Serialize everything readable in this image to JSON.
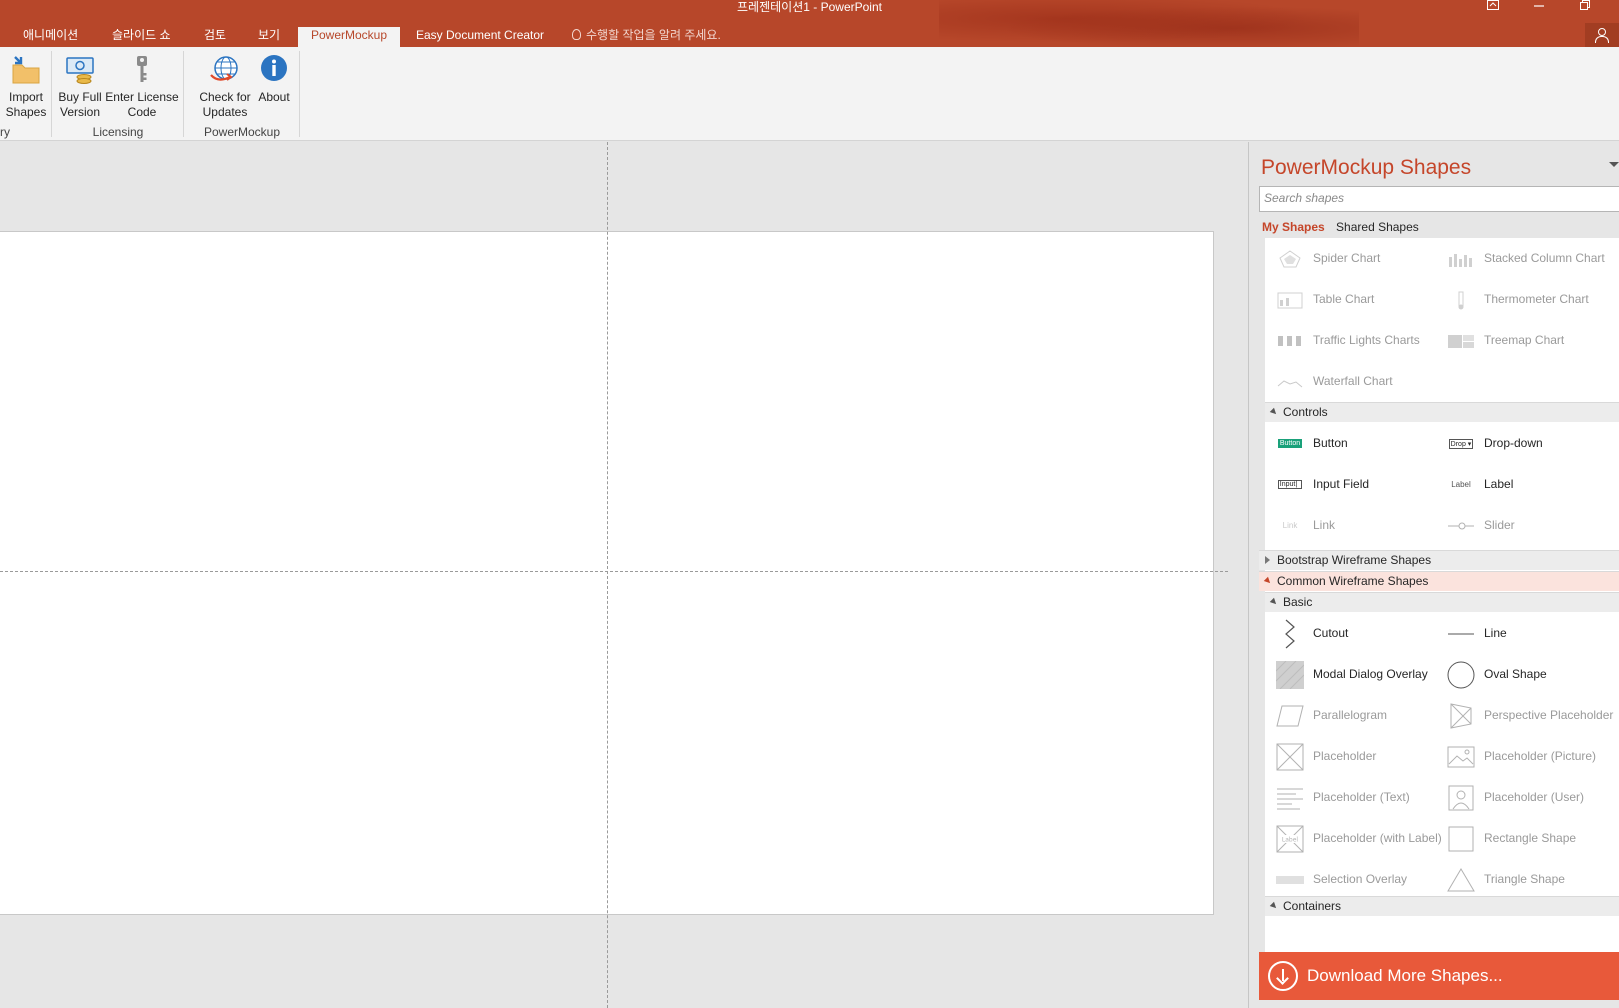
{
  "window": {
    "title": "프레젠테이션1 - PowerPoint",
    "controls": [
      "restore-ribbon",
      "minimize",
      "restore"
    ]
  },
  "tabs": [
    {
      "label": "애니메이션",
      "active": false
    },
    {
      "label": "슬라이드 쇼",
      "active": false
    },
    {
      "label": "검토",
      "active": false
    },
    {
      "label": "보기",
      "active": false
    },
    {
      "label": "PowerMockup",
      "active": true
    },
    {
      "label": "Easy Document Creator",
      "active": false
    }
  ],
  "tell_me": "수행할 작업을 알려 주세요.",
  "ribbon": {
    "buttons": [
      {
        "label1": "Import",
        "label2": "Shapes",
        "icon": "folder-import-icon"
      },
      {
        "label1": "Buy Full",
        "label2": "Version",
        "icon": "money-icon"
      },
      {
        "label1": "Enter License",
        "label2": "Code",
        "icon": "key-icon"
      },
      {
        "label1": "Check for",
        "label2": "Updates",
        "icon": "globe-update-icon"
      },
      {
        "label1": "About",
        "label2": "",
        "icon": "info-icon"
      }
    ],
    "groups": [
      "ry",
      "Licensing",
      "PowerMockup"
    ]
  },
  "pane": {
    "title": "PowerMockup Shapes",
    "search_placeholder": "Search shapes",
    "tab_my": "My Shapes",
    "tab_shared": "Shared Shapes",
    "charts": [
      [
        "Spider Chart",
        "Stacked Column Chart"
      ],
      [
        "Table Chart",
        "Thermometer Chart"
      ],
      [
        "Traffic Lights Charts",
        "Treemap Chart"
      ],
      [
        "Waterfall Chart",
        ""
      ]
    ],
    "controls_header": "Controls",
    "controls": [
      [
        "Button",
        "Drop-down"
      ],
      [
        "Input Field",
        "Label"
      ],
      [
        "Link",
        "Slider"
      ]
    ],
    "control_thumbs": {
      "button": "Button",
      "dropdown": "Drop ▾",
      "input": "Input|",
      "label": "Label",
      "link": "Link"
    },
    "bootstrap_header": "Bootstrap Wireframe Shapes",
    "common_header": "Common Wireframe Shapes",
    "basic_header": "Basic",
    "basic": [
      [
        "Cutout",
        "Line"
      ],
      [
        "Modal Dialog Overlay",
        "Oval Shape"
      ],
      [
        "Parallelogram",
        "Perspective Placeholder"
      ],
      [
        "Placeholder",
        "Placeholder (Picture)"
      ],
      [
        "Placeholder (Text)",
        "Placeholder (User)"
      ],
      [
        "Placeholder (with Label)",
        "Rectangle Shape"
      ],
      [
        "Selection Overlay",
        "Triangle Shape"
      ]
    ],
    "placeholder_label_thumb": "Label",
    "containers_header": "Containers",
    "download": "Download More Shapes..."
  },
  "colors": {
    "accent": "#b7472a",
    "pane_accent": "#c5462a",
    "download": "#e8593a",
    "button_green": "#1aa17a"
  }
}
